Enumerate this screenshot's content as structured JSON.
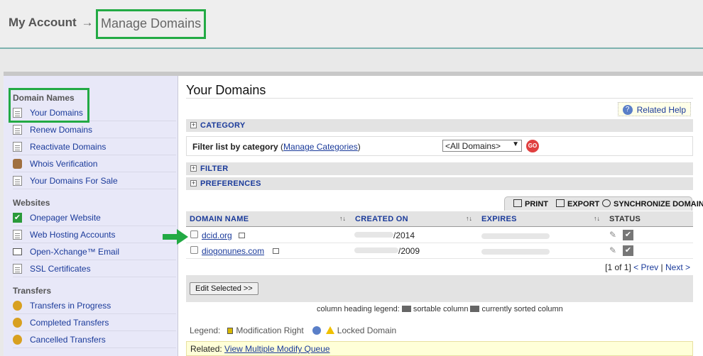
{
  "breadcrumb": {
    "root": "My Account",
    "separator": "→",
    "current": "Manage Domains"
  },
  "sidebar": {
    "sections": [
      {
        "title": "Domain Names",
        "items": [
          {
            "label": "Your Domains",
            "icon": "document-icon"
          },
          {
            "label": "Renew Domains",
            "icon": "document-icon"
          },
          {
            "label": "Reactivate Domains",
            "icon": "document-icon"
          },
          {
            "label": "Whois Verification",
            "icon": "person-lock-icon"
          },
          {
            "label": "Your Domains For Sale",
            "icon": "document-icon"
          }
        ]
      },
      {
        "title": "Websites",
        "items": [
          {
            "label": "Onepager Website",
            "icon": "checkmark-icon"
          },
          {
            "label": "Web Hosting Accounts",
            "icon": "document-icon"
          },
          {
            "label": "Open-Xchange™ Email",
            "icon": "envelope-icon"
          },
          {
            "label": "SSL Certificates",
            "icon": "certificate-icon"
          }
        ]
      },
      {
        "title": "Transfers",
        "items": [
          {
            "label": "Transfers in Progress",
            "icon": "transfer-icon"
          },
          {
            "label": "Completed Transfers",
            "icon": "transfer-icon"
          },
          {
            "label": "Cancelled Transfers",
            "icon": "transfer-icon"
          }
        ]
      }
    ]
  },
  "main": {
    "title": "Your Domains",
    "related_help": "Related Help",
    "category_label": "CATEGORY",
    "filter_by_category": "Filter list by category",
    "manage_categories": "Manage Categories",
    "category_select": "<All Domains>",
    "go_label": "GO",
    "filter_label": "FILTER",
    "preferences_label": "PREFERENCES",
    "tabs": {
      "print": "PRINT",
      "export": "EXPORT",
      "sync": "SYNCHRONIZE DOMAINS"
    },
    "columns": {
      "domain": "DOMAIN NAME",
      "created": "CREATED ON",
      "expires": "EXPIRES",
      "status": "STATUS"
    },
    "rows": [
      {
        "domain": "dcid.org",
        "created_visible": "/2014"
      },
      {
        "domain": "diogonunes.com",
        "created_visible": "/2009"
      }
    ],
    "pager": {
      "position": "[1 of 1]",
      "prev": "< Prev",
      "sep": "|",
      "next": "Next >"
    },
    "edit_selected": "Edit Selected >>",
    "heading_legend": {
      "prefix": "column heading legend:",
      "sortable": "sortable column",
      "sorted": "currently sorted column"
    },
    "legend": {
      "label": "Legend:",
      "modification": "Modification Right",
      "locked": "Locked Domain"
    },
    "related": {
      "label": "Related:",
      "link": "View Multiple Modify Queue"
    }
  },
  "colors": {
    "highlight": "#22aa44",
    "link": "#1a3a9a",
    "sidebar_bg": "#e8e8f8"
  }
}
